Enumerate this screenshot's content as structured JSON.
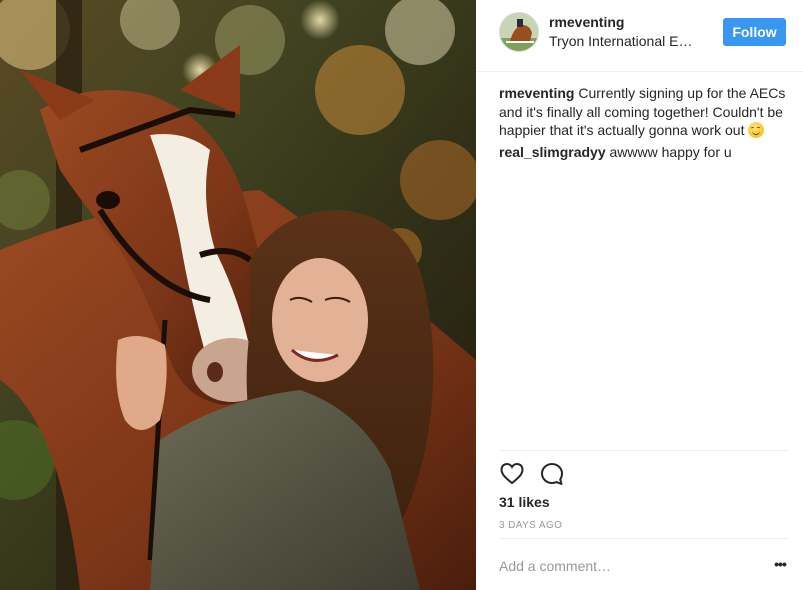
{
  "post": {
    "username": "rmeventing",
    "location": "Tryon International Equestrian Center",
    "follow_label": "Follow",
    "caption_author": "rmeventing",
    "caption_text": "Currently signing up for the AECs and it's finally all coming together! Couldn't be happier that it's actually gonna work out",
    "caption_emoji": "smiling-face-emoji"
  },
  "comments": [
    {
      "author": "real_slimgradyy",
      "text": "awwww happy for u"
    }
  ],
  "actions": {
    "like_icon": "heart-outline-icon",
    "comment_icon": "speech-bubble-icon",
    "likes": "31 likes",
    "timestamp": "3 DAYS AGO"
  },
  "add_comment": {
    "placeholder": "Add a comment…",
    "more_label": "•••"
  },
  "colors": {
    "follow_button": "#3897f0",
    "text": "#262626",
    "muted": "#999999",
    "divider": "#efefef"
  }
}
